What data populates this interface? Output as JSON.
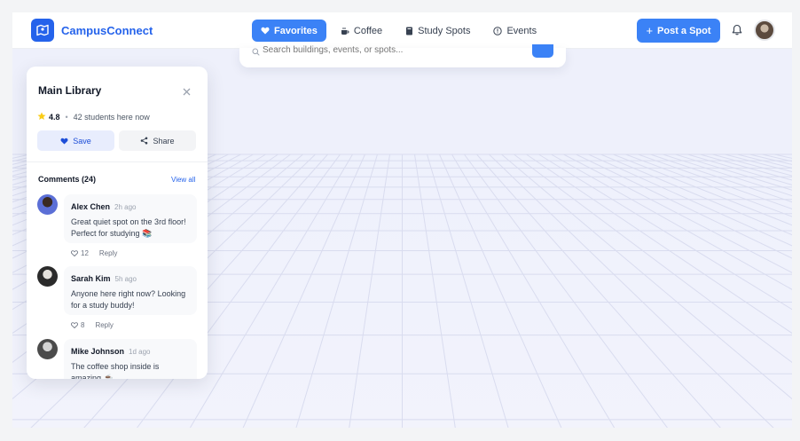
{
  "app": {
    "name": "CampusConnect",
    "brand_color": "#2563eb",
    "accent_color": "#3b82f6"
  },
  "nav": {
    "tabs": [
      {
        "label": "Favorites",
        "icon": "heart-icon",
        "active": true
      },
      {
        "label": "Coffee",
        "icon": "coffee-icon",
        "active": false
      },
      {
        "label": "Study Spots",
        "icon": "book-icon",
        "active": false
      },
      {
        "label": "Events",
        "icon": "info-icon",
        "active": false
      }
    ],
    "post_button": "Post a Spot"
  },
  "search": {
    "placeholder": "Search buildings, events, or spots..."
  },
  "panel": {
    "title": "Main Library",
    "rating": "4.8",
    "students_here": "42 students here now",
    "save_label": "Save",
    "share_label": "Share",
    "comments_heading": "Comments (24)",
    "view_all": "View all",
    "comments": [
      {
        "name": "Alex Chen",
        "time": "2h ago",
        "text": "Great quiet spot on the 3rd floor! Perfect for studying 📚",
        "likes": "12",
        "reply": "Reply"
      },
      {
        "name": "Sarah Kim",
        "time": "5h ago",
        "text": "Anyone here right now? Looking for a study buddy!",
        "likes": "8",
        "reply": "Reply"
      },
      {
        "name": "Mike Johnson",
        "time": "1d ago",
        "text": "The coffee shop inside is amazing ☕",
        "likes": "",
        "reply": ""
      }
    ]
  }
}
